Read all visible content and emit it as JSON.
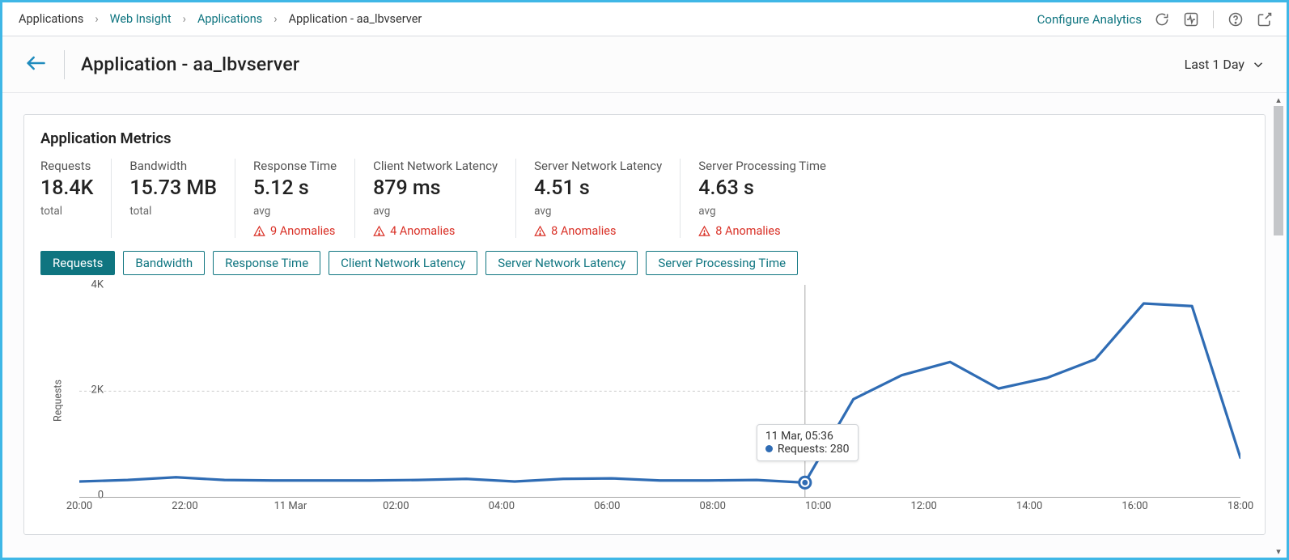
{
  "breadcrumbs": {
    "items": [
      {
        "label": "Applications",
        "link": false
      },
      {
        "label": "Web Insight",
        "link": true
      },
      {
        "label": "Applications",
        "link": true
      },
      {
        "label": "Application - aa_lbvserver",
        "link": false
      }
    ],
    "configure": "Configure Analytics"
  },
  "header": {
    "title": "Application - aa_lbvserver",
    "time_range": "Last 1 Day"
  },
  "card": {
    "title": "Application Metrics",
    "metrics": [
      {
        "label": "Requests",
        "value": "18.4K",
        "sub": "total",
        "anom": null
      },
      {
        "label": "Bandwidth",
        "value": "15.73 MB",
        "sub": "total",
        "anom": null
      },
      {
        "label": "Response Time",
        "value": "5.12 s",
        "sub": "avg",
        "anom": "9 Anomalies"
      },
      {
        "label": "Client Network Latency",
        "value": "879 ms",
        "sub": "avg",
        "anom": "4 Anomalies"
      },
      {
        "label": "Server Network Latency",
        "value": "4.51 s",
        "sub": "avg",
        "anom": "8 Anomalies"
      },
      {
        "label": "Server Processing Time",
        "value": "4.63 s",
        "sub": "avg",
        "anom": "8 Anomalies"
      }
    ],
    "tabs": [
      "Requests",
      "Bandwidth",
      "Response Time",
      "Client Network Latency",
      "Server Network Latency",
      "Server Processing Time"
    ],
    "active_tab": 0
  },
  "tooltip": {
    "time": "11 Mar, 05:36",
    "series": "Requests",
    "value": "280"
  },
  "chart_data": {
    "type": "line",
    "ylabel": "Requests",
    "xlabel": "",
    "ylim": [
      0,
      4000
    ],
    "yticks": [
      {
        "v": 0,
        "l": "0"
      },
      {
        "v": 2000,
        "l": "2K"
      },
      {
        "v": 4000,
        "l": "4K"
      }
    ],
    "xticks": [
      "20:00",
      "22:00",
      "11 Mar",
      "02:00",
      "04:00",
      "06:00",
      "08:00",
      "10:00",
      "12:00",
      "14:00",
      "16:00",
      "18:00"
    ],
    "x_count_total": 12,
    "series": [
      {
        "name": "Requests",
        "color": "#2f6cb4",
        "values": [
          {
            "t": "20:00",
            "y": 300
          },
          {
            "t": "21:00",
            "y": 330
          },
          {
            "t": "22:00",
            "y": 380
          },
          {
            "t": "23:00",
            "y": 330
          },
          {
            "t": "11 Mar",
            "y": 320
          },
          {
            "t": "01:00",
            "y": 320
          },
          {
            "t": "02:00",
            "y": 320
          },
          {
            "t": "03:00",
            "y": 330
          },
          {
            "t": "04:00",
            "y": 350
          },
          {
            "t": "05:00",
            "y": 300
          },
          {
            "t": "06:00",
            "y": 350
          },
          {
            "t": "07:00",
            "y": 360
          },
          {
            "t": "08:00",
            "y": 320
          },
          {
            "t": "09:00",
            "y": 320
          },
          {
            "t": "10:00",
            "y": 330
          },
          {
            "t": "11:00",
            "y": 280
          },
          {
            "t": "12:00",
            "y": 1850
          },
          {
            "t": "13:00",
            "y": 2300
          },
          {
            "t": "14:00",
            "y": 2550
          },
          {
            "t": "15:00",
            "y": 2050
          },
          {
            "t": "16:00",
            "y": 2250
          },
          {
            "t": "17:00",
            "y": 2600
          },
          {
            "t": "17:30",
            "y": 3650
          },
          {
            "t": "18:00",
            "y": 3600
          },
          {
            "t": "18:30",
            "y": 750
          }
        ],
        "highlight_index": 15
      }
    ]
  }
}
